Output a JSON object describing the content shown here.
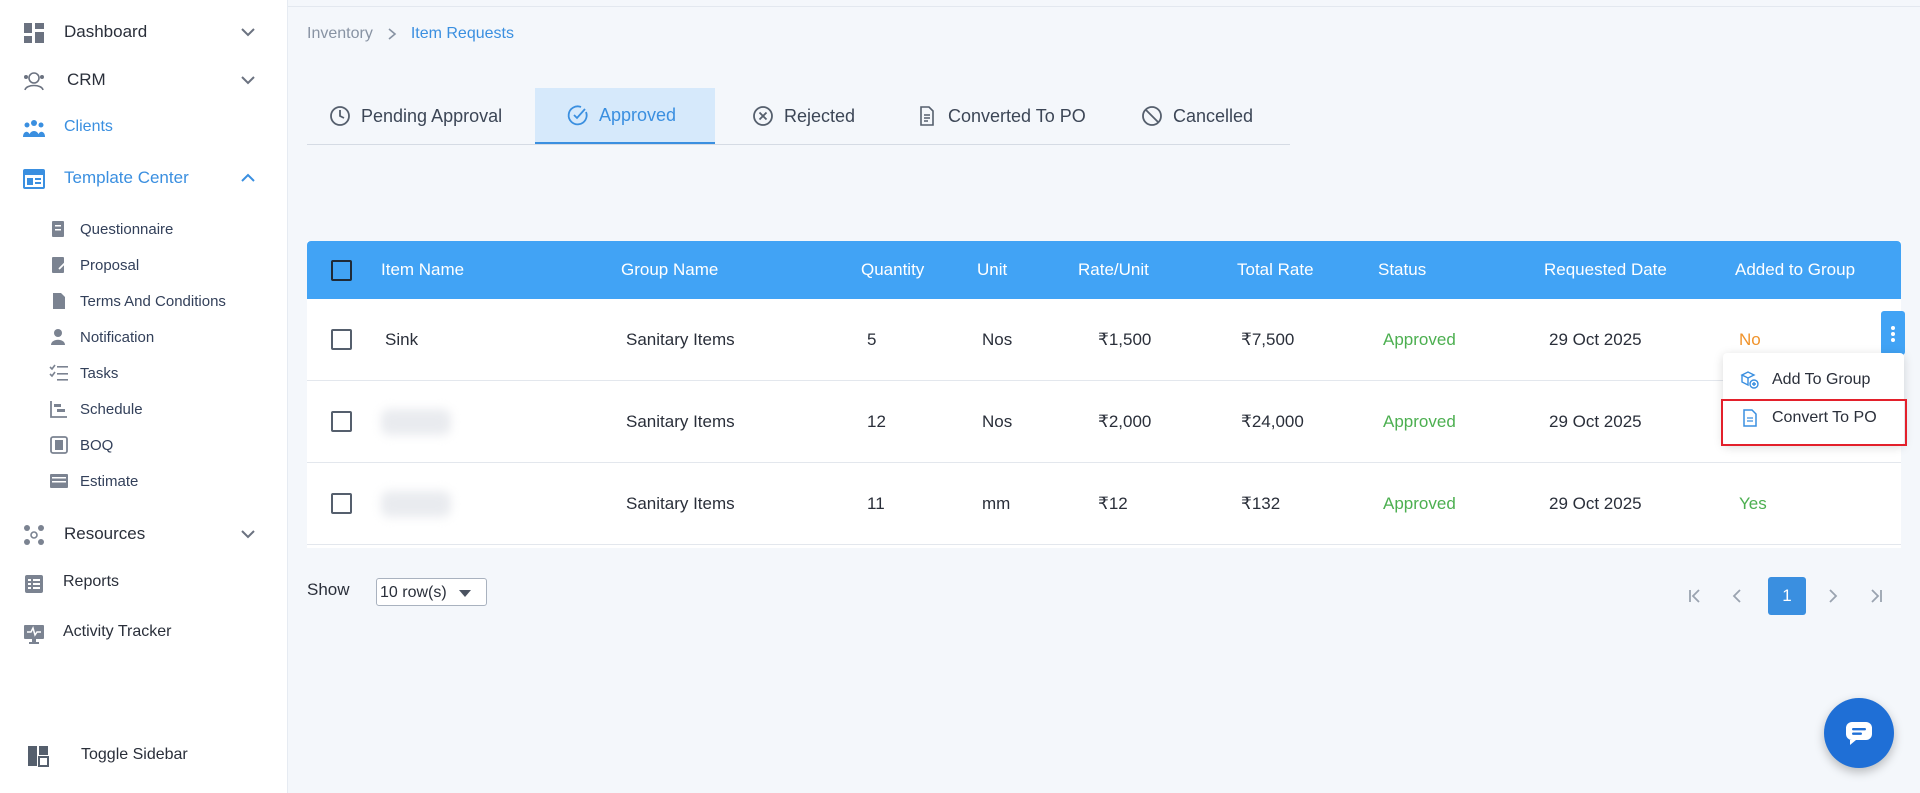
{
  "sidebar": {
    "items": [
      {
        "label": "Dashboard"
      },
      {
        "label": "CRM"
      },
      {
        "label": "Clients"
      },
      {
        "label": "Template Center"
      },
      {
        "label": "Resources"
      },
      {
        "label": "Reports"
      },
      {
        "label": "Activity Tracker"
      }
    ],
    "template_center_items": [
      {
        "label": "Questionnaire"
      },
      {
        "label": "Proposal"
      },
      {
        "label": "Terms And Conditions"
      },
      {
        "label": "Notification"
      },
      {
        "label": "Tasks"
      },
      {
        "label": "Schedule"
      },
      {
        "label": "BOQ"
      },
      {
        "label": "Estimate"
      }
    ],
    "toggle_label": "Toggle Sidebar"
  },
  "breadcrumb": {
    "parent": "Inventory",
    "current": "Item Requests"
  },
  "tabs": [
    {
      "label": "Pending Approval"
    },
    {
      "label": "Approved"
    },
    {
      "label": "Rejected"
    },
    {
      "label": "Converted To PO"
    },
    {
      "label": "Cancelled"
    }
  ],
  "table": {
    "headers": [
      "Item Name",
      "Group Name",
      "Quantity",
      "Unit",
      "Rate/Unit",
      "Total Rate",
      "Status",
      "Requested Date",
      "Added to Group"
    ],
    "rows": [
      {
        "item_name": "Sink",
        "group_name": "Sanitary Items",
        "quantity": "5",
        "unit": "Nos",
        "rate_unit": "₹1,500",
        "total_rate": "₹7,500",
        "status": "Approved",
        "requested_date": "29 Oct 2025",
        "added_to_group": "No"
      },
      {
        "item_name": "",
        "group_name": "Sanitary Items",
        "quantity": "12",
        "unit": "Nos",
        "rate_unit": "₹2,000",
        "total_rate": "₹24,000",
        "status": "Approved",
        "requested_date": "29 Oct 2025",
        "added_to_group": ""
      },
      {
        "item_name": "",
        "group_name": "Sanitary Items",
        "quantity": "11",
        "unit": "mm",
        "rate_unit": "₹12",
        "total_rate": "₹132",
        "status": "Approved",
        "requested_date": "29 Oct 2025",
        "added_to_group": "Yes"
      }
    ]
  },
  "row_menu": {
    "items": [
      {
        "label": "Add To Group"
      },
      {
        "label": "Convert To PO"
      }
    ]
  },
  "footer": {
    "show_label": "Show",
    "rows_per_page": "10 row(s)",
    "current_page": "1"
  },
  "colors": {
    "accent": "#3a8fe0",
    "header": "#41a3f5",
    "approved": "#4caf50",
    "no": "#f0932b",
    "highlight": "#e3202b"
  }
}
